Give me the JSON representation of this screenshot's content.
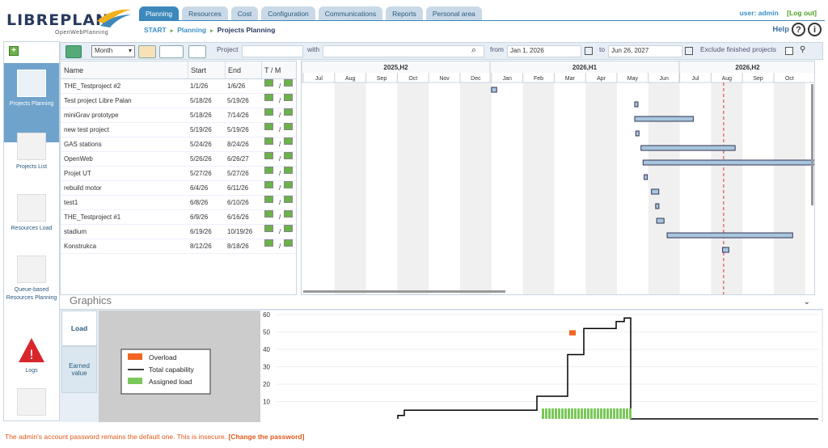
{
  "app": {
    "logo_text": "LIBREPLAN",
    "logo_sub": "OpenWebPlanning"
  },
  "tabs": [
    "Planning",
    "Resources",
    "Cost",
    "Configuration",
    "Communications",
    "Reports",
    "Personal area"
  ],
  "user": {
    "label": "user: admin",
    "logout": "[Log out]"
  },
  "breadcrumb": {
    "start": "START",
    "planning": "Planning",
    "current": "Projects Planning"
  },
  "help": {
    "label": "Help"
  },
  "sidebar": [
    {
      "label": "Projects Planning"
    },
    {
      "label": "Projects List"
    },
    {
      "label": "Resources Load"
    },
    {
      "label": "Queue-based Resources Planning"
    },
    {
      "label": "Logs"
    }
  ],
  "toolbar": {
    "zoom": "Month",
    "project_label": "Project",
    "with_label": "with",
    "from_label": "from",
    "from_value": "Jan 1, 2026",
    "to_label": "to",
    "to_value": "Jun 26, 2027",
    "exclude_label": "Exclude finished projects"
  },
  "grid": {
    "headers": {
      "name": "Name",
      "start": "Start",
      "end": "End",
      "tm": "T / M"
    },
    "rows": [
      {
        "name": "THE_Testproject #2",
        "start": "1/1/26",
        "end": "1/6/26"
      },
      {
        "name": "Test project Libre Palan",
        "start": "5/18/26",
        "end": "5/19/26"
      },
      {
        "name": "miniGrav prototype",
        "start": "5/18/26",
        "end": "7/14/26"
      },
      {
        "name": "new test project",
        "start": "5/19/26",
        "end": "5/19/26"
      },
      {
        "name": "GAS stations",
        "start": "5/24/26",
        "end": "8/24/26"
      },
      {
        "name": "OpenWeb",
        "start": "5/26/26",
        "end": "6/26/27"
      },
      {
        "name": "Projet UT",
        "start": "5/27/26",
        "end": "5/27/26"
      },
      {
        "name": "rebuild motor",
        "start": "6/4/26",
        "end": "6/11/26"
      },
      {
        "name": "test1",
        "start": "6/8/26",
        "end": "6/10/26"
      },
      {
        "name": "THE_Testproject #1",
        "start": "6/9/26",
        "end": "6/16/26"
      },
      {
        "name": "stadium",
        "start": "6/19/26",
        "end": "10/19/26"
      },
      {
        "name": "Konstrukca",
        "start": "8/12/26",
        "end": "8/18/26"
      }
    ]
  },
  "gantt": {
    "groups": [
      "2025,H2",
      "2026,H1",
      "2026,H2"
    ],
    "months": [
      "Jul",
      "Aug",
      "Sep",
      "Oct",
      "Nov",
      "Dec",
      "Jan",
      "Feb",
      "Mar",
      "Apr",
      "May",
      "Jun",
      "Jul",
      "Aug",
      "Sep",
      "Oct"
    ]
  },
  "graphics": {
    "title": "Graphics",
    "tab_load": "Load",
    "tab_earned": "Earned value",
    "legend": [
      "Overload",
      "Total capability",
      "Assigned load"
    ],
    "ylabels": [
      "60",
      "50",
      "40",
      "30",
      "20",
      "10"
    ]
  },
  "colors": {
    "overload": "#f26522",
    "capability": "#000000",
    "assigned": "#7bc85a",
    "bar": "#a7c6dd",
    "accent": "#3d88bb"
  },
  "warning": {
    "text": "The admin's account password remains the default one. This is insecure.",
    "link": "[Change the password]"
  }
}
